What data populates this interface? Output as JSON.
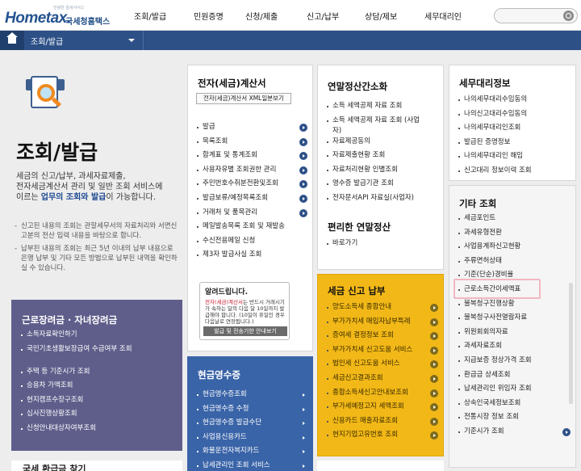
{
  "header": {
    "slogan": "안녕한 알세서서스",
    "logo_text": "Hometax.",
    "logo_kr": "국세청홈택스",
    "nav": [
      "조회/발급",
      "민원증명",
      "신청/제출",
      "신고/납부",
      "상담/제보",
      "세무대리인"
    ]
  },
  "breadcrumb": {
    "label": "조회/발급"
  },
  "page": {
    "title": "조회/발급",
    "desc1": "세금의 신고/납부, 과세자료제출,",
    "desc2": "전자세금계산서 관리 및 일반 조회 서비스에",
    "desc3_pre": "이르는 ",
    "desc3_hl": "업무의 조회와 발급",
    "desc3_post": "이 가능합니다.",
    "notes": [
      "신고된 내용의 조회는 관할세무서의 자료처리와 서면신고분의 전산 입력 내용을 바탕으로 합니다.",
      "납부된 내용의 조회는 최근 5년 이내의 납부 내용으로 은행 납부 및 기타 모든 방법으로 납부된 내역을 확인하실 수 있습니다."
    ]
  },
  "panels": {
    "etax": {
      "title": "전자(세금)계산서",
      "tag": "전자(세금)계산서 XML일분보기",
      "items": [
        "발급",
        "목록조회",
        "합계표 및 통계조회",
        "사용자유별 조회권한 관리",
        "주민번호수취분전환및조회",
        "발급보류/예정목록조회",
        "거래처 및 품목관리",
        "메일발송목록 조회 및 재발송",
        "수신전용메일 신청",
        "제3자 발급사실 조회"
      ]
    },
    "notice": {
      "title": "알려드립니다.",
      "body_pre": "전자(세금)계산서",
      "body_post": "는 반드시 거래시기가 속하는 달의 다음 달 10일까지 발급해야 합니다. (10일이 휴일인 경우 다음날로 연장됩니다.)",
      "button": "발급 및 전송기한 안내보기"
    },
    "cash": {
      "title": "현금영수증",
      "items": [
        "현금영수증조회",
        "현금영수증 수정",
        "현금영수증 발급수단",
        "사업용신용카드",
        "화물운전자복지카드",
        "납세관리인 조회 서비스"
      ]
    },
    "yearend": {
      "title": "연말정산간소화",
      "items": [
        "소득 세액공제 자료 조회",
        "소득 세액공제 자료 조회 (사업자)",
        "자료제공동의",
        "자료제출현황 조회",
        "자료처리현황 인별조회",
        "영수증 발급기관 조회",
        "전자문서API 자료실(사업자)"
      ]
    },
    "convenient": {
      "title": "편리한 연말정산",
      "items": [
        "바로가기"
      ]
    },
    "taxreport": {
      "title": "세금 신고 납부",
      "items": [
        "양도소득세 종합안내",
        "부가가치세 매입자납부특례",
        "증여세 결정정보 조회",
        "부가가치세 신고도움 서비스",
        "법인세 신고도움 서비스",
        "세금신고결과조회",
        "종합소득세신고안내보조회",
        "부가세예정고지 세액조회",
        "신용카드 매출자료조회",
        "현지기업고유번호 조회"
      ]
    },
    "agent": {
      "title": "세무대리정보",
      "items": [
        "나의세무대리수임동의",
        "나의신고대리수임동의",
        "나의세무대리인조회",
        "발급된 증명정보",
        "나의세무대리인 해임",
        "신고대리 정보이력 조회"
      ]
    },
    "other": {
      "title": "기타 조회",
      "items": [
        "세금포인트",
        "과세유형전환",
        "사업용계좌신고현황",
        "주류면허상태",
        "기준(단순)경비율",
        "근로소득간이세액표",
        "불복청구진행상황",
        "불복청구사전열람자료",
        "위원회회의자료",
        "과세자료조회",
        "지급보증 정상가격 조회",
        "환급금 상세조회",
        "납세관리인 위임자 조회",
        "상속인국세정보조회",
        "전통시장 정보 조회",
        "기준시가 조회"
      ]
    },
    "labor": {
      "title": "근로장려금 · 자녀장려금",
      "items": [
        "소득자료확인하기",
        "국민기초생활보장급여 수급여부 조회",
        "주택 등 기준시가 조회",
        "승용차 가액조회",
        "현지캠프수장구조회",
        "심사진행상황조회",
        "신청안내대상자여부조회"
      ]
    },
    "bottom": {
      "title": "국세 환급금 찾기"
    }
  },
  "colors": {
    "brand": "#24538f",
    "subnav": "#2d5087",
    "purple": "#5f5e8b",
    "blue": "#3a64a8",
    "yellow": "#f2b817",
    "highlight": "#f1b8c2"
  }
}
